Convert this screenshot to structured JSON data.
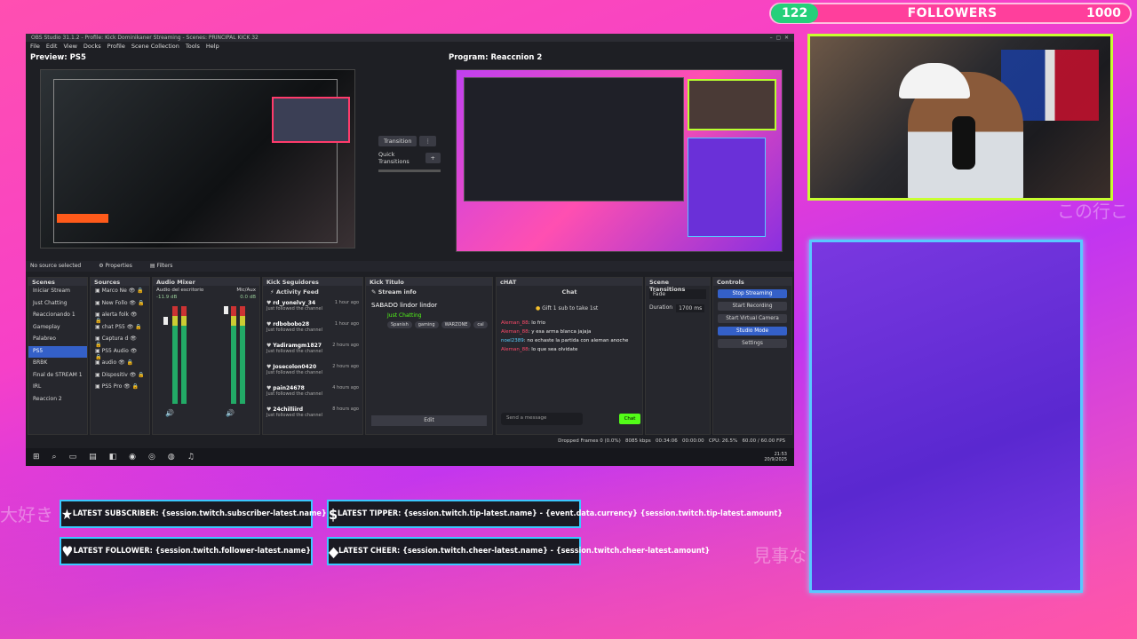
{
  "follower_goal": {
    "current": "122",
    "label": "FOLLOWERS",
    "goal": "1000",
    "progress_fraction": 0.122
  },
  "overlay_text": {
    "jp1": "この行こ",
    "jp2": "大好き",
    "jp3": "見事な"
  },
  "obs": {
    "title": "OBS Studio 31.1.2 - Profile: Kick Dominikaner Streaming - Scenes: PRINCIPAL KICK 32",
    "menu": [
      "File",
      "Edit",
      "View",
      "Docks",
      "Profile",
      "Scene Collection",
      "Tools",
      "Help"
    ],
    "preview_label": "Preview: PS5",
    "program_label": "Program: Reaccnion 2",
    "transition_label": "Transition",
    "quick_transitions_label": "Quick Transitions",
    "source_bar": {
      "no_source": "No source selected",
      "properties": "Properties",
      "filters": "Filters",
      "zoom": "30%",
      "scale": "Scale to Window"
    },
    "scenes": {
      "title": "Scenes",
      "items": [
        "Iniciar Stream",
        "Just Chatting",
        "Reaccionando 1",
        "Gameplay",
        "Palabreo",
        "PS5",
        "BRBK",
        "Final de STREAM 1",
        "IRL",
        "Reaccion 2"
      ],
      "selected": "PS5"
    },
    "sources": {
      "title": "Sources",
      "items": [
        "Marco Ne",
        "New Follo",
        "alerta folk",
        "chat PS5",
        "Captura d",
        "PS5 Audio",
        "audio",
        "Dispositiv",
        "PS5 Pro"
      ]
    },
    "mixer": {
      "title": "Audio Mixer",
      "ch1": "Audio del escritorio",
      "ch1_db": "-11.9 dB",
      "ch2": "Mic/Aux",
      "ch2_db": "0.0 dB"
    },
    "kick_followers": {
      "title": "Kick Seguidores",
      "header": "Activity Feed",
      "items": [
        {
          "name": "rd_yonelvy_34",
          "time": "1 hour ago",
          "text": "Just followed the channel"
        },
        {
          "name": "rdbobobo28",
          "time": "1 hour ago",
          "text": "Just followed the channel"
        },
        {
          "name": "Yadiramgm1827",
          "time": "2 hours ago",
          "text": "Just followed the channel"
        },
        {
          "name": "Josecolon0420",
          "time": "2 hours ago",
          "text": "Just followed the channel"
        },
        {
          "name": "pain24678",
          "time": "4 hours ago",
          "text": "Just followed the channel"
        },
        {
          "name": "24chilliird",
          "time": "8 hours ago",
          "text": "Just followed the channel"
        }
      ]
    },
    "kick_title": {
      "title": "Kick Titulo",
      "header": "Stream info",
      "stream_title": "SABADO lindor lindor",
      "category": "Just Chatting",
      "tags": [
        "Spanish",
        "gaming",
        "WARZONE",
        "cal"
      ],
      "edit": "Edit"
    },
    "chat": {
      "title": "cHAT",
      "header": "Chat",
      "gift": "Gift 1 sub to take 1st",
      "messages": [
        {
          "user": "Aleman_88",
          "text": ": lo frio"
        },
        {
          "user": "Aleman_88",
          "text": ": y esa arma blanca jajaja"
        },
        {
          "user": "noel2389",
          "text": ": no echaste la partida con aleman anoche"
        },
        {
          "user": "Aleman_88",
          "text": ": lo que sea olvidate"
        }
      ],
      "placeholder": "Send a message",
      "send": "Chat"
    },
    "scene_transitions": {
      "title": "Scene Transitions",
      "type": "Fade",
      "duration_label": "Duration",
      "duration": "1700 ms"
    },
    "controls": {
      "title": "Controls",
      "buttons": [
        "Stop Streaming",
        "Start Recording",
        "Start Virtual Camera",
        "Studio Mode",
        "Settings"
      ]
    },
    "status": {
      "dropped": "Dropped Frames 0 (0.0%)",
      "kbps": "8085 kbps",
      "live": "00:34:06",
      "rec": "00:00:00",
      "cpu": "CPU: 26.5%",
      "fps": "60.00 / 60.00 FPS"
    },
    "clock": {
      "time": "21:53",
      "date": "20/9/2025"
    }
  },
  "alerts": {
    "subscriber": "LATEST SUBSCRIBER: {session.twitch.subscriber-latest.name}",
    "tipper": "LATEST TIPPER: {session.twitch.tip-latest.name} - {event.data.currency} {session.twitch.tip-latest.amount}",
    "follower": "LATEST FOLLOWER: {session.twitch.follower-latest.name}",
    "cheer": "LATEST CHEER: {session.twitch.cheer-latest.name} - {session.twitch.cheer-latest.amount}"
  }
}
